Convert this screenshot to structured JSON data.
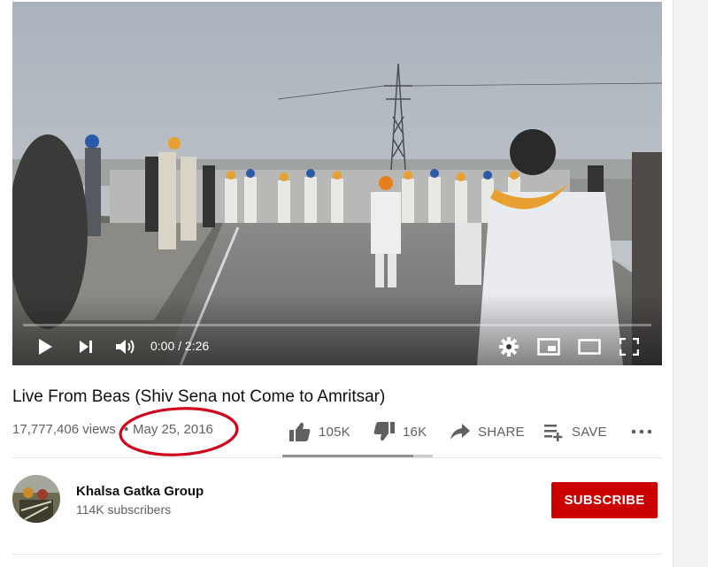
{
  "player": {
    "current_time": "0:00",
    "duration": "2:26",
    "time_separator": " / ",
    "progress": 0.0,
    "icons": {
      "play": "play-icon",
      "next": "skip-next-icon",
      "volume": "volume-icon",
      "settings": "gear-icon",
      "miniplayer": "miniplayer-icon",
      "theater": "theater-mode-icon",
      "fullscreen": "fullscreen-icon"
    }
  },
  "video": {
    "title": "Live From Beas (Shiv Sena not Come to Amritsar)",
    "views": "17,777,406 views",
    "separator": "•",
    "date": "May 25, 2016",
    "annotation_color": "#d0021b"
  },
  "actions": {
    "like": {
      "label": "105K",
      "icon": "thumbs-up-icon"
    },
    "dislike": {
      "label": "16K",
      "icon": "thumbs-down-icon"
    },
    "share": {
      "label": "SHARE",
      "icon": "share-icon"
    },
    "save": {
      "label": "SAVE",
      "icon": "playlist-add-icon"
    },
    "more": {
      "icon": "more-horizontal-icon"
    },
    "like_ratio": 0.87
  },
  "channel": {
    "name": "Khalsa Gatka Group",
    "subscribers": "114K subscribers",
    "avatar": "channel-avatar"
  },
  "subscribe": {
    "label": "SUBSCRIBE",
    "color": "#cc0000"
  }
}
